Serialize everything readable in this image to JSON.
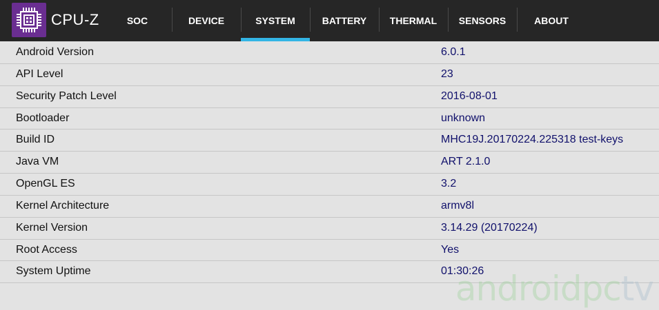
{
  "app": {
    "title": "CPU-Z",
    "logo_icon": "cpu-chip-icon",
    "accent_color": "#33b5e5",
    "logo_color": "#6a2e91"
  },
  "tabs": [
    {
      "label": "SOC",
      "active": false
    },
    {
      "label": "DEVICE",
      "active": false
    },
    {
      "label": "SYSTEM",
      "active": true
    },
    {
      "label": "BATTERY",
      "active": false
    },
    {
      "label": "THERMAL",
      "active": false
    },
    {
      "label": "SENSORS",
      "active": false
    },
    {
      "label": "ABOUT",
      "active": false
    }
  ],
  "system_info": [
    {
      "label": "Android Version",
      "value": "6.0.1"
    },
    {
      "label": "API Level",
      "value": "23"
    },
    {
      "label": "Security Patch Level",
      "value": "2016-08-01"
    },
    {
      "label": "Bootloader",
      "value": "unknown"
    },
    {
      "label": "Build ID",
      "value": "MHC19J.20170224.225318 test-keys"
    },
    {
      "label": "Java VM",
      "value": "ART 2.1.0"
    },
    {
      "label": "OpenGL ES",
      "value": "3.2"
    },
    {
      "label": "Kernel Architecture",
      "value": "armv8l"
    },
    {
      "label": "Kernel Version",
      "value": "3.14.29 (20170224)"
    },
    {
      "label": "Root Access",
      "value": "Yes"
    },
    {
      "label": "System Uptime",
      "value": "01:30:26"
    }
  ],
  "watermark": {
    "part1": "android",
    "part2": "pc",
    "part3": "tv"
  }
}
